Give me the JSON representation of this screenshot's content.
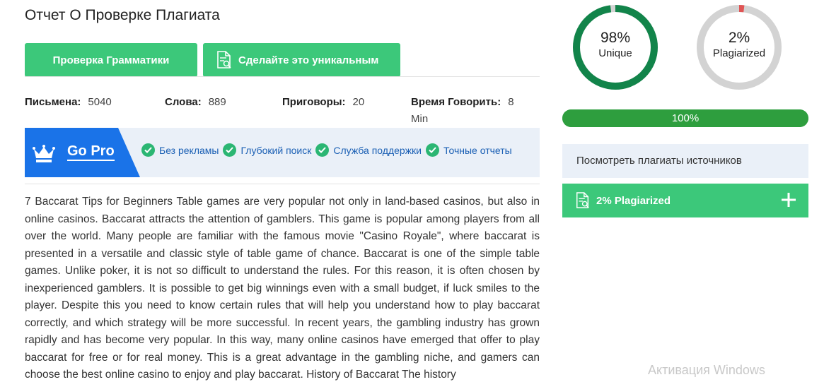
{
  "header": {
    "title": "Отчет О Проверке Плагиата"
  },
  "actions": {
    "grammar_label": "Проверка Грамматики",
    "unique_label": "Сделайте это уникальным"
  },
  "stats": [
    {
      "label": "Письмена:",
      "value": "5040"
    },
    {
      "label": "Слова:",
      "value": "889"
    },
    {
      "label": "Приговоры:",
      "value": "20"
    },
    {
      "label": "Время Говорить:",
      "value": "8 Min"
    }
  ],
  "promo": {
    "badge": "Go Pro",
    "features": [
      "Без рекламы",
      "Глубокий поиск",
      "Служба поддержки",
      "Точные отчеты"
    ]
  },
  "article": {
    "text": "7 Baccarat Tips for Beginners Table games are very popular not only in land-based casinos, but also in online casinos. Baccarat attracts the attention of gamblers. This game is popular among players from all over the world. Many people are familiar with the famous movie \"Casino Royale\", where baccarat is presented in a versatile and classic style of table game of chance. Baccarat is one of the simple table games. Unlike poker, it is not so difficult to understand the rules. For this reason, it is often chosen by inexperienced gamblers. It is possible to get big winnings even with a small budget, if luck smiles to the player. Despite this you need to know certain rules that will help you understand how to play baccarat correctly, and which strategy will be more successful. In recent years, the gambling industry has grown rapidly and has become very popular. In this way, many online casinos have emerged that offer to play baccarat for free or for real money. This is a great advantage in the gambling niche, and gamers can choose the best online casino to enjoy and play baccarat. History of Baccarat The history"
  },
  "results": {
    "unique": {
      "percent": "98%",
      "label": "Unique",
      "value": 0.98,
      "color": "#12844a"
    },
    "plagiarized": {
      "percent": "2%",
      "label": "Plagiarized",
      "value": 0.02,
      "color": "#e05454"
    },
    "ring_track_color": "#d3d3d3",
    "progress": {
      "label": "100%",
      "value": 1.0,
      "color": "#2e9e3e"
    }
  },
  "sources": {
    "view_label": "Посмотреть плагиаты источников",
    "plag_label": "2% Plagiarized",
    "expand_icon": "plus-icon"
  },
  "system": {
    "watermark": "Активация Windows"
  },
  "colors": {
    "accent_green": "#3cc87a",
    "brand_blue": "#1a73e8",
    "panel_bg": "#eaf0f8"
  }
}
